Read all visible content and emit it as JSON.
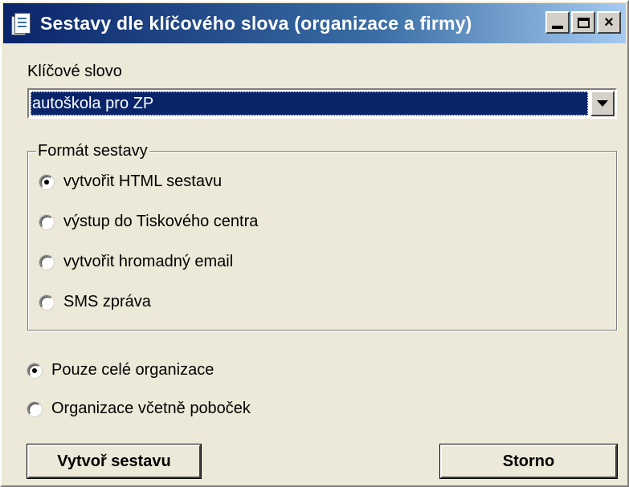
{
  "window": {
    "title": "Sestavy dle klíčového slova (organizace a firmy)",
    "controls": {
      "minimize": "minimize",
      "maximize": "maximize",
      "close": "×"
    }
  },
  "keyword": {
    "label": "Klíčové slovo",
    "selected": "autoškola pro ZP"
  },
  "format_group": {
    "legend": "Formát sestavy",
    "options": [
      {
        "label": "vytvořit HTML sestavu",
        "checked": true
      },
      {
        "label": "výstup do Tiskového centra",
        "checked": false
      },
      {
        "label": "vytvořit hromadný email",
        "checked": false
      },
      {
        "label": "SMS zpráva",
        "checked": false
      }
    ]
  },
  "scope": {
    "options": [
      {
        "label": "Pouze celé organizace",
        "checked": true
      },
      {
        "label": "Organizace včetně poboček",
        "checked": false
      }
    ]
  },
  "buttons": {
    "create": "Vytvoř sestavu",
    "cancel": "Storno"
  },
  "icons": {
    "title": "document-icon",
    "dropdown": "chevron-down-icon"
  }
}
